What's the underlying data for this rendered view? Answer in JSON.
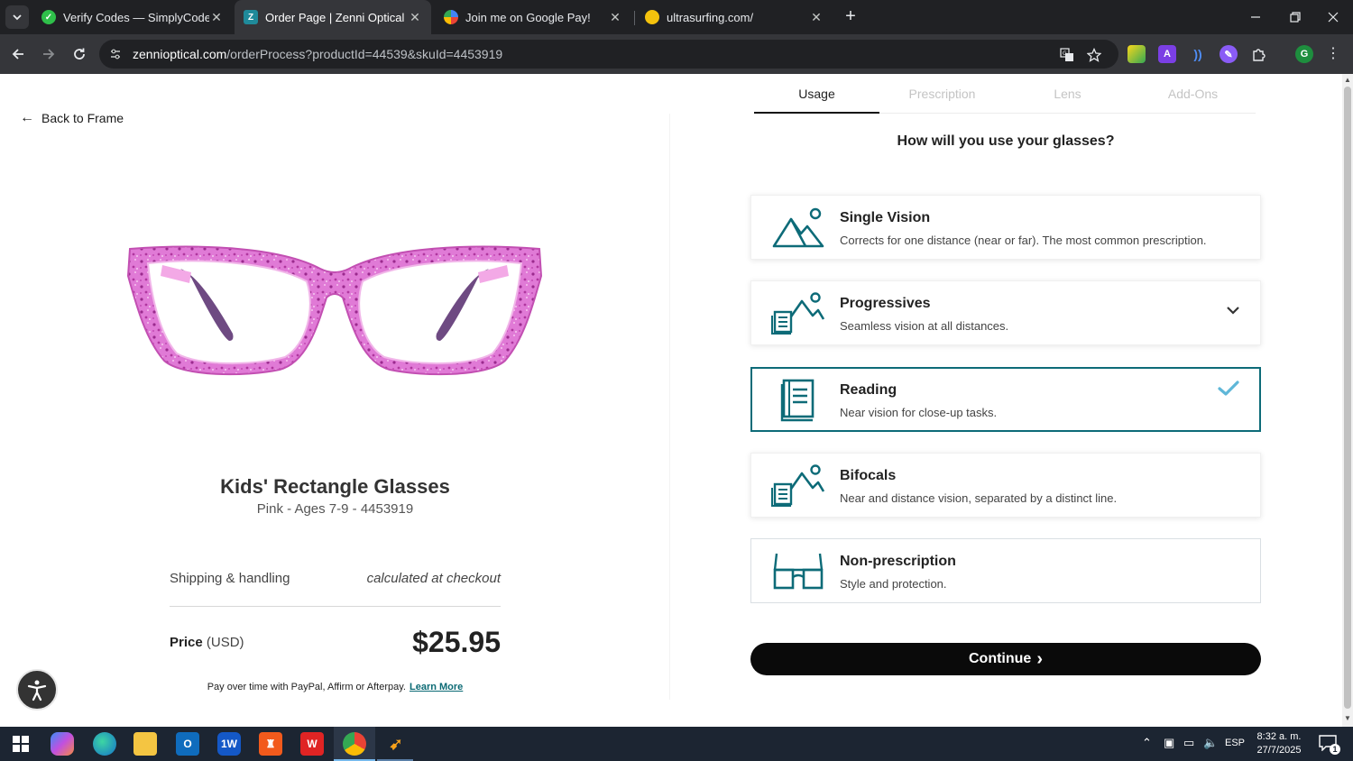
{
  "browser": {
    "tabs": [
      {
        "title": "Verify Codes — SimplyCodes",
        "favicon": "simplycodes-icon",
        "active": false
      },
      {
        "title": "Order Page | Zenni Optical",
        "favicon": "zenni-icon",
        "active": true
      },
      {
        "title": "Join me on Google Pay!",
        "favicon": "google-pay-icon",
        "active": false
      },
      {
        "title": "ultrasurfing.com/",
        "favicon": "ultrasurf-icon",
        "active": false
      }
    ],
    "url_host": "zennioptical.com",
    "url_path": "/orderProcess?productId=44539&skuId=4453919",
    "profile_initial": "G"
  },
  "page": {
    "back_label": "Back to Frame",
    "steps": [
      "Usage",
      "Prescription",
      "Lens",
      "Add-Ons"
    ],
    "active_step": "Usage",
    "question": "How will you use your glasses?",
    "options": [
      {
        "title": "Single Vision",
        "desc": "Corrects for one distance (near or far). The most common prescription.",
        "icon": "mountain-icon"
      },
      {
        "title": "Progressives",
        "desc": "Seamless vision at all distances.",
        "icon": "mountain-book-icon"
      },
      {
        "title": "Reading",
        "desc": "Near vision for close-up tasks.",
        "icon": "book-icon",
        "selected": true
      },
      {
        "title": "Bifocals",
        "desc": "Near and distance vision, separated by a distinct line.",
        "icon": "mountain-book-icon"
      },
      {
        "title": "Non-prescription",
        "desc": "Style and protection.",
        "icon": "glasses-icon"
      }
    ],
    "continue_label": "Continue",
    "continue_arrow": "›",
    "product": {
      "name": "Kids' Rectangle Glasses",
      "subtitle": "Pink - Ages 7-9 - 4453919",
      "shipping_label": "Shipping & handling",
      "shipping_value": "calculated at checkout",
      "price_label": "Price",
      "price_currency": "(USD)",
      "price": "$25.95",
      "paylater_text": "Pay over time with PayPal, Affirm or Afterpay.",
      "learn_more": "Learn More"
    }
  },
  "colors": {
    "accent": "#0d6b78",
    "frame_pink": "#d95cc9"
  },
  "taskbar": {
    "lang": "ESP",
    "time": "8:32 a. m.",
    "date": "27/7/2025",
    "notif_count": "1"
  }
}
